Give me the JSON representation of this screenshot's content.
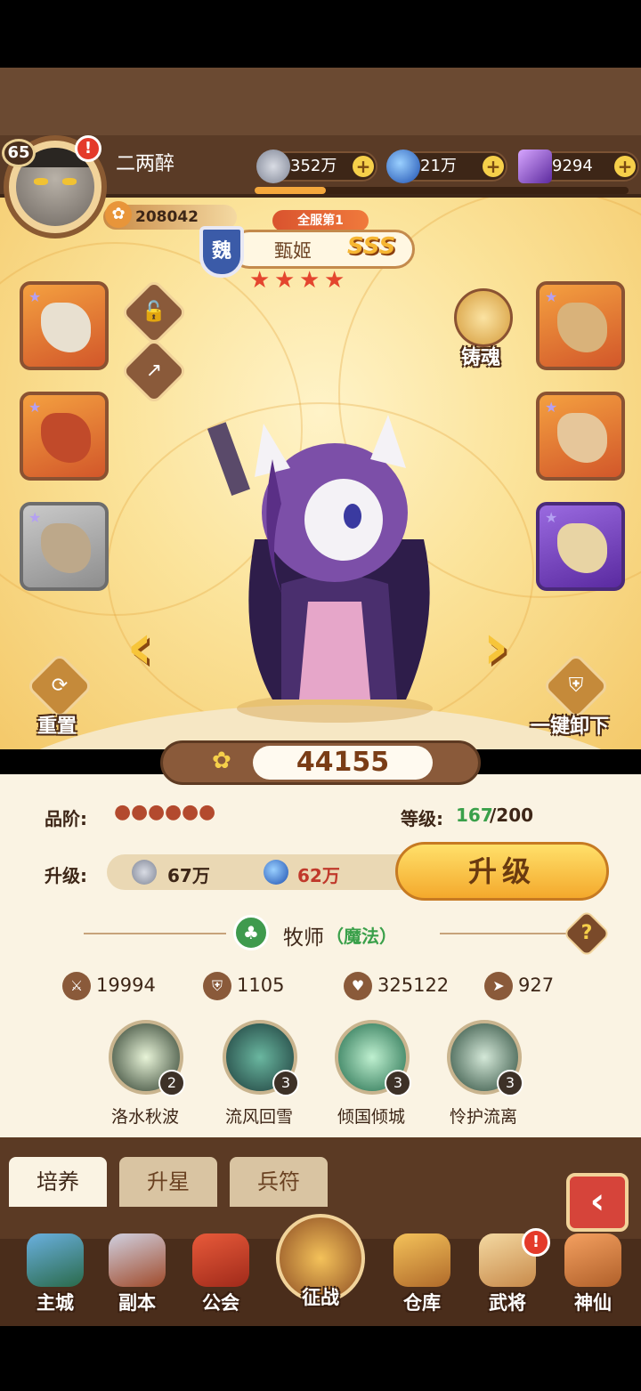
{
  "player": {
    "level": "65",
    "name": "二两醉",
    "score": "208042",
    "alert": "!"
  },
  "resources": [
    {
      "icon": "silver-coin-icon",
      "value": "352万"
    },
    {
      "icon": "blue-orb-icon",
      "value": "21万"
    },
    {
      "icon": "purple-crystal-icon",
      "value": "9294"
    }
  ],
  "hero": {
    "rank_badge": "全服第1",
    "faction": "魏",
    "name": "甄姬",
    "grade": "SSS",
    "stars": 4
  },
  "actions": {
    "soul_forge": "铸魂",
    "reset": "重置",
    "unequip_all": "一键卸下"
  },
  "power": "44155",
  "stats_panel": {
    "quality_label": "品阶:",
    "level_label": "等级:",
    "level_current": "167",
    "level_max": "/200",
    "upgrade_label": "升级:",
    "cost_silver": "67万",
    "cost_orb": "62万",
    "upgrade_button": "升级",
    "class_name": "牧师",
    "class_type": "（魔法）",
    "help": "?"
  },
  "stats": [
    {
      "icon": "sword-icon",
      "value": "19994"
    },
    {
      "icon": "shield-icon",
      "value": "1105"
    },
    {
      "icon": "heart-icon",
      "value": "325122"
    },
    {
      "icon": "boot-icon",
      "value": "927"
    }
  ],
  "skills": [
    {
      "name": "洛水秋波",
      "level": "2"
    },
    {
      "name": "流风回雪",
      "level": "3"
    },
    {
      "name": "倾国倾城",
      "level": "3"
    },
    {
      "name": "怜护流离",
      "level": "3"
    }
  ],
  "tabs": [
    "培养",
    "升星",
    "兵符"
  ],
  "nav": [
    "主城",
    "副本",
    "公会",
    "征战",
    "仓库",
    "武将",
    "神仙"
  ],
  "colors": {
    "accent": "#f4a92c",
    "panel": "#faf3e3",
    "brown": "#5b3a24",
    "red": "#e4452e"
  }
}
